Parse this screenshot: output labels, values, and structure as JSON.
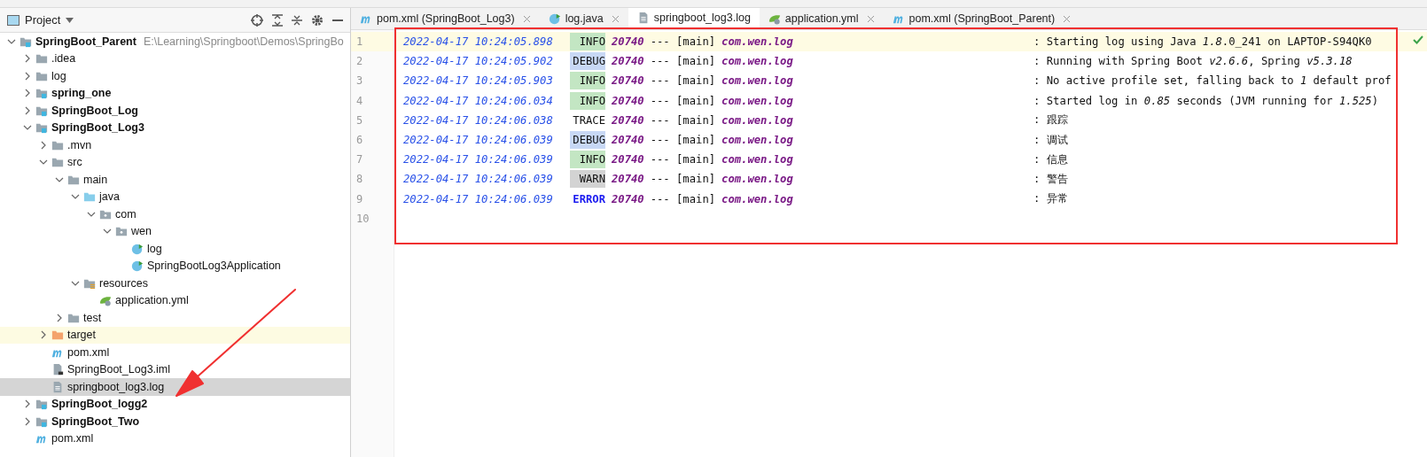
{
  "project_panel": {
    "title": "Project",
    "tree": [
      {
        "label": "SpringBoot_Parent",
        "path": "E:\\Learning\\Springboot\\Demos\\SpringBo",
        "kind": "module",
        "bold": true,
        "expanded": true,
        "selected": false,
        "children": [
          {
            "label": ".idea",
            "kind": "folder",
            "bold": false,
            "expanded": false,
            "selected": false
          },
          {
            "label": "log",
            "kind": "folder",
            "bold": false,
            "expanded": false,
            "selected": false
          },
          {
            "label": "spring_one",
            "kind": "module",
            "bold": true,
            "expanded": false,
            "selected": false
          },
          {
            "label": "SpringBoot_Log",
            "kind": "module",
            "bold": true,
            "expanded": false,
            "selected": false
          },
          {
            "label": "SpringBoot_Log3",
            "kind": "module",
            "bold": true,
            "expanded": true,
            "selected": false,
            "children": [
              {
                "label": ".mvn",
                "kind": "folder",
                "bold": false,
                "expanded": false,
                "selected": false
              },
              {
                "label": "src",
                "kind": "folder",
                "bold": false,
                "expanded": true,
                "selected": false,
                "children": [
                  {
                    "label": "main",
                    "kind": "folder",
                    "bold": false,
                    "expanded": true,
                    "selected": false,
                    "children": [
                      {
                        "label": "java",
                        "kind": "source",
                        "bold": false,
                        "expanded": true,
                        "selected": false,
                        "children": [
                          {
                            "label": "com",
                            "kind": "package",
                            "bold": false,
                            "expanded": true,
                            "selected": false,
                            "children": [
                              {
                                "label": "wen",
                                "kind": "package",
                                "bold": false,
                                "expanded": true,
                                "selected": false,
                                "children": [
                                  {
                                    "label": "log",
                                    "kind": "class",
                                    "bold": false,
                                    "selected": false
                                  },
                                  {
                                    "label": "SpringBootLog3Application",
                                    "kind": "class",
                                    "bold": false,
                                    "selected": false
                                  }
                                ]
                              }
                            ]
                          }
                        ]
                      },
                      {
                        "label": "resources",
                        "kind": "resources",
                        "bold": false,
                        "expanded": true,
                        "selected": false,
                        "children": [
                          {
                            "label": "application.yml",
                            "kind": "yml",
                            "bold": false,
                            "selected": false
                          }
                        ]
                      }
                    ]
                  },
                  {
                    "label": "test",
                    "kind": "folder",
                    "bold": false,
                    "expanded": false,
                    "selected": false
                  }
                ]
              },
              {
                "label": "target",
                "kind": "excluded",
                "bold": false,
                "expanded": false,
                "selected": false
              },
              {
                "label": "pom.xml",
                "kind": "maven",
                "bold": false,
                "selected": false
              },
              {
                "label": "SpringBoot_Log3.iml",
                "kind": "iml",
                "bold": false,
                "selected": false
              },
              {
                "label": "springboot_log3.log",
                "kind": "text",
                "bold": false,
                "selected": true
              }
            ]
          },
          {
            "label": "SpringBoot_logg2",
            "kind": "module",
            "bold": true,
            "expanded": false,
            "selected": false
          },
          {
            "label": "SpringBoot_Two",
            "kind": "module",
            "bold": true,
            "expanded": false,
            "selected": false
          },
          {
            "label": "pom.xml",
            "kind": "maven",
            "bold": false,
            "selected": false
          }
        ]
      }
    ]
  },
  "tabs": [
    {
      "label": "pom.xml (SpringBoot_Log3)",
      "kind": "maven",
      "selected": false
    },
    {
      "label": "log.java",
      "kind": "class",
      "selected": false
    },
    {
      "label": "springboot_log3.log",
      "kind": "text",
      "selected": true
    },
    {
      "label": "application.yml",
      "kind": "yml",
      "selected": false
    },
    {
      "label": "pom.xml (SpringBoot_Parent)",
      "kind": "maven",
      "selected": false
    }
  ],
  "log_lines": [
    {
      "number": "1",
      "time": "2022-04-17 10:24:05.898",
      "severity": "INFO",
      "pid": "20740",
      "thread": "--- [main]",
      "logger": "com.wen.log",
      "message": ": Starting log using Java *1.8*.0_241 on LAPTOP-S94QK0",
      "current": true
    },
    {
      "number": "2",
      "time": "2022-04-17 10:24:05.902",
      "severity": "DEBUG",
      "pid": "20740",
      "thread": "--- [main]",
      "logger": "com.wen.log",
      "message": ": Running with Spring Boot *v2.6.6*, Spring *v5.3.18*",
      "current": false
    },
    {
      "number": "3",
      "time": "2022-04-17 10:24:05.903",
      "severity": "INFO",
      "pid": "20740",
      "thread": "--- [main]",
      "logger": "com.wen.log",
      "message": ": No active profile set, falling back to *1* default prof",
      "current": false
    },
    {
      "number": "4",
      "time": "2022-04-17 10:24:06.034",
      "severity": "INFO",
      "pid": "20740",
      "thread": "--- [main]",
      "logger": "com.wen.log",
      "message": ": Started log in *0.85* seconds (JVM running for *1.525*)",
      "current": false
    },
    {
      "number": "5",
      "time": "2022-04-17 10:24:06.038",
      "severity": "TRACE",
      "pid": "20740",
      "thread": "--- [main]",
      "logger": "com.wen.log",
      "message": ": 跟踪",
      "current": false
    },
    {
      "number": "6",
      "time": "2022-04-17 10:24:06.039",
      "severity": "DEBUG",
      "pid": "20740",
      "thread": "--- [main]",
      "logger": "com.wen.log",
      "message": ": 调试",
      "current": false
    },
    {
      "number": "7",
      "time": "2022-04-17 10:24:06.039",
      "severity": "INFO",
      "pid": "20740",
      "thread": "--- [main]",
      "logger": "com.wen.log",
      "message": ": 信息",
      "current": false
    },
    {
      "number": "8",
      "time": "2022-04-17 10:24:06.039",
      "severity": "WARN",
      "pid": "20740",
      "thread": "--- [main]",
      "logger": "com.wen.log",
      "message": ": 警告",
      "current": false
    },
    {
      "number": "9",
      "time": "2022-04-17 10:24:06.039",
      "severity": "ERROR",
      "pid": "20740",
      "thread": "--- [main]",
      "logger": "com.wen.log",
      "message": ": 异常",
      "current": false
    },
    {
      "number": "10"
    }
  ]
}
